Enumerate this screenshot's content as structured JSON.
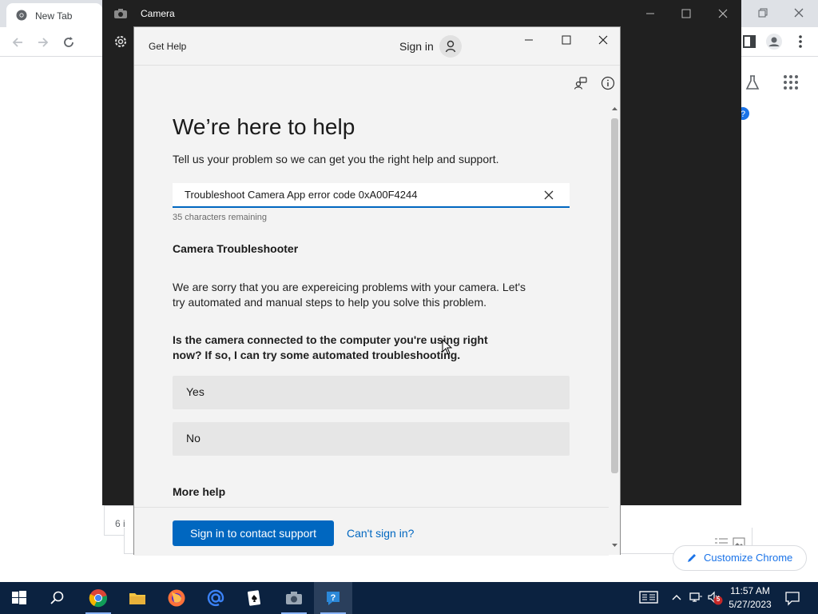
{
  "chrome": {
    "tab_title": "New Tab",
    "partial_number": "6 i",
    "customize_label": "Customize Chrome"
  },
  "camera": {
    "title": "Camera"
  },
  "gethelp": {
    "title": "Get Help",
    "sign_in": "Sign in",
    "heading": "We’re here to help",
    "subtitle": "Tell us your problem so we can get you the right help and support.",
    "search_value": "Troubleshoot Camera App error code 0xA00F4244",
    "chars_remaining": "35 characters remaining",
    "section_title": "Camera Troubleshooter",
    "sorry_text": "We are sorry that you are expereicing problems with your camera. Let's try automated and manual steps to help you solve this problem.",
    "question_text": "Is the camera connected to the computer you're using right now? If so, I can try some automated troubleshooting.",
    "choices": [
      {
        "label": "Yes"
      },
      {
        "label": "No"
      }
    ],
    "more_help": "More help",
    "contact_button": "Sign in to contact support",
    "cant_sign_in": "Can't sign in?"
  },
  "taskbar": {
    "time": "11:57 AM",
    "date": "5/27/2023",
    "notification_count": "5"
  }
}
